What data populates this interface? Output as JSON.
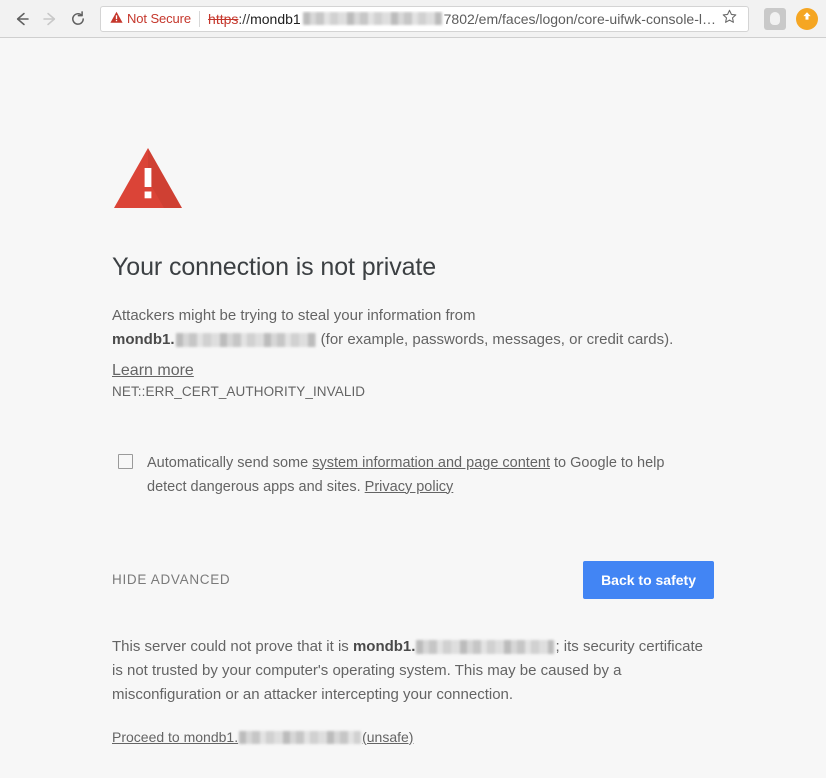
{
  "browser": {
    "back_icon": "back-arrow-icon",
    "forward_icon": "forward-arrow-icon",
    "reload_icon": "reload-icon",
    "security_label": "Not Secure",
    "security_icon": "warning-triangle-icon",
    "url": {
      "scheme": "https",
      "separator": "://",
      "host_visible": "mondb1",
      "host_redacted": true,
      "path": "7802/em/faces/logon/core-uifwk-console-l…"
    },
    "star_icon": "bookmark-star-icon",
    "extension_icon": "extension-icon",
    "profile_icon": "profile-update-icon"
  },
  "interstitial": {
    "warning_icon": "error-triangle-icon",
    "title": "Your connection is not private",
    "para1_line1": "Attackers might be trying to steal your information from",
    "para1_host_bold": "mondb1.",
    "para1_tail": " (for example, passwords, messages, or credit cards).",
    "learn_more": "Learn more",
    "error_code": "NET::ERR_CERT_AUTHORITY_INVALID",
    "optin": {
      "checked": false,
      "text_before_link": "Automatically send some ",
      "link1": "system information and page content",
      "text_middle": " to Google to help detect dangerous apps and sites. ",
      "link2": "Privacy policy"
    },
    "hide_advanced": "HIDE ADVANCED",
    "back_to_safety": "Back to safety",
    "advanced": {
      "text_before_host": "This server could not prove that it is ",
      "host_bold": "mondb1.",
      "text_after_host": "; its security certificate is not trusted by your computer's operating system. This may be caused by a misconfiguration or an attacker intercepting your connection."
    },
    "proceed": {
      "prefix": "Proceed to mondb1.",
      "suffix": "(unsafe)"
    }
  },
  "colors": {
    "warning_red": "#db4437",
    "not_secure_red": "#c5372c",
    "button_blue": "#4285f4",
    "page_bg": "#f7f7f7",
    "text_grey": "#646464",
    "profile_orange": "#f5a623"
  }
}
